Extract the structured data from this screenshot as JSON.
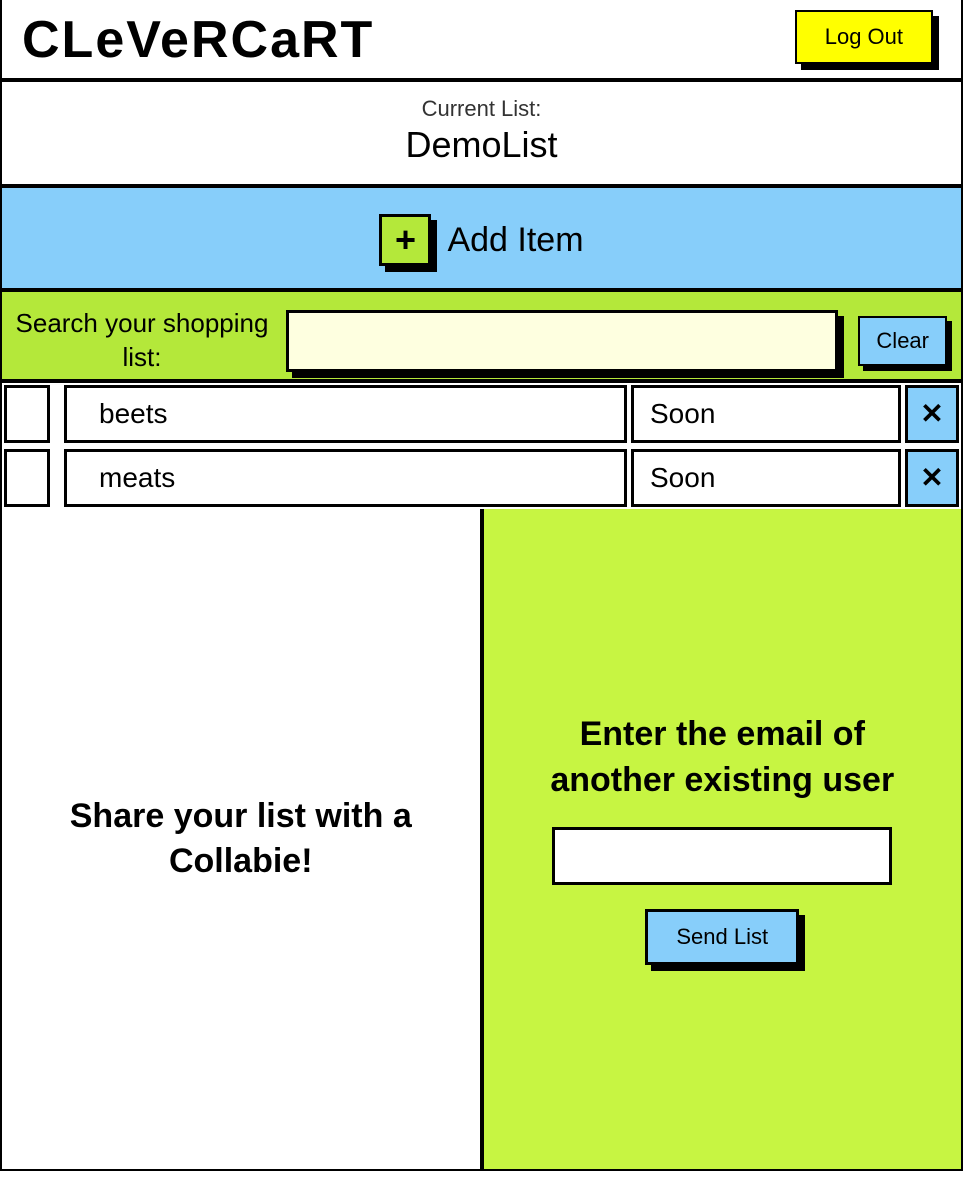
{
  "header": {
    "logo": "CLeVeRCaRT",
    "logout_label": "Log Out"
  },
  "current_list": {
    "label": "Current List:",
    "name": "DemoList"
  },
  "add_item": {
    "plus": "+",
    "label": "Add Item"
  },
  "search": {
    "label": "Search your shopping list:",
    "value": "",
    "clear_label": "Clear"
  },
  "items": [
    {
      "name": "beets",
      "status": "Soon",
      "close": "✕"
    },
    {
      "name": "meats",
      "status": "Soon",
      "close": "✕"
    }
  ],
  "share": {
    "title": "Share your list with a Collabie!",
    "prompt": "Enter the email of another existing user",
    "email_value": "",
    "send_label": "Send List"
  }
}
